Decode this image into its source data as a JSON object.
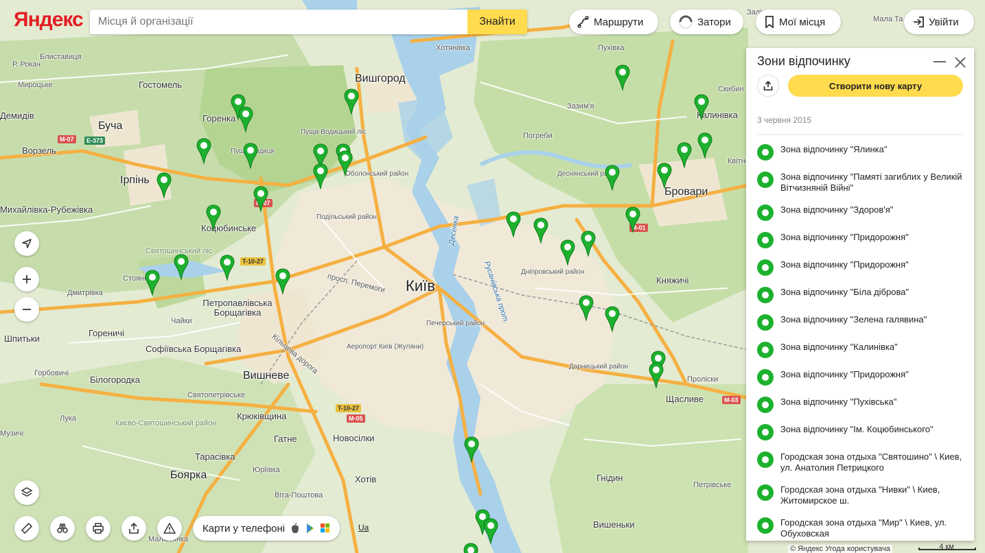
{
  "brand": {
    "logo": "Яндекс"
  },
  "search": {
    "placeholder": "Місця й організації",
    "value": "",
    "submit_label": "Знайти"
  },
  "top_buttons": {
    "routes": "Маршрути",
    "traffic": "Затори",
    "my_places": "Мої місця",
    "login": "Увійти"
  },
  "map": {
    "places": {
      "kyiv": "Київ",
      "vyshhorod": "Вишгород",
      "brovary": "Бровари",
      "irpin": "Ірпінь",
      "bucha": "Буча",
      "hostomel": "Гостомель",
      "vorzel": "Ворзель",
      "horenka": "Горенка",
      "kotsiubynske": "Коцюбинське",
      "boiarka": "Боярка",
      "vyshneve": "Вишневе",
      "vyshenky": "Вишеньки",
      "shchaslyve": "Щасливе",
      "petropavlivska": "Петропавлівська Борщагівка",
      "sofiivska": "Софіївська Борщагівка",
      "kniazhychi": "Княжичі",
      "kalynivka": "Калинівка",
      "pukhivka": "Пухівка",
      "hnidyn": "Гнідин",
      "khotiv": "Хотів",
      "novosilky": "Новосілки",
      "hatne": "Гатне",
      "kriukivshchyna": "Крюківщина",
      "tarasivka": "Тарасівка",
      "biluhorodka": "Білогородка",
      "horenychi": "Гореничі",
      "shpytky": "Шпитьки",
      "mykhailivka": "Михайлівка-Рубежівка",
      "bilytske": "Блиставиця",
      "myrotske": "Мироцьке",
      "demydiv": "Демидів",
      "khotianivka": "Хотянівка",
      "pohreby": "Погреби",
      "zazymia": "Зазим'я",
      "chaiky": "Чайки",
      "stoianka": "Стоянка",
      "dmytrivka": "Дмитрівка",
      "horbovychi": "Горбовичі",
      "luka": "Лука",
      "muzychi": "Музичі",
      "novosilky2": "Новосілки",
      "yurivka": "Юріївка",
      "vyta_poshtova": "Віта-Поштова",
      "malyutanka": "Малютянка",
      "sviatopetrivske": "Святопетрівське",
      "pushcha": "Пуща-Водицький ліс",
      "desnianskyi": "Деснянський район",
      "obolonskyi": "Оболонський район",
      "podilskyi": "Подільський район",
      "dniprovskyi": "Дніпровський район",
      "pecherskyi": "Печерський район",
      "darnytskyi": "Дарницький район",
      "airport": "Аеропорт Київ (Жуляни)",
      "prosp_peremohy": "просп. Перемоги",
      "kiltseva": "Кільцева дорога",
      "rusanivska": "Русанівська прот.",
      "desenka": "Десенка",
      "prolisky": "Проліски",
      "kyievo_sviatoshynskyi": "Києво-Святошинський район",
      "sviatoshynskyi": "Святошинський ліс",
      "skybyn": "Скибин",
      "kvitneve": "Квітневе",
      "zalissia": "Заліс",
      "mala_tataryvka": "Мала Та",
      "rokach": "Р. Рокач",
      "petrivske": "Петрівське",
      "puszcha_ditsia": "Пуща-Водиця"
    },
    "shields": {
      "m07a": "M-07",
      "e373": "E-373",
      "m07b": "M-07",
      "t1027a": "T-10-27",
      "t1027b": "T-10-27",
      "m05": "M-05",
      "m01": "M-01",
      "m03": "M-03"
    },
    "marker_count": 37
  },
  "controls": {
    "phone_label": "Карти у телефоні",
    "lang_link": "Ua"
  },
  "panel": {
    "title": "Зони відпочинку",
    "create_label": "Створити нову карту",
    "date": "3 червня 2015",
    "items": [
      "Зона відпочинку \"Ялинка\"",
      "Зона відпочинку \"Памяті загиблих у Великій Вітчизняній Війні\"",
      "Зона відпочинку \"Здоров'я\"",
      "Зона відпочинку \"Придорожня\"",
      "Зона відпочинку \"Придорожня\"",
      "Зона відпочинку \"Біла діброва\"",
      "Зона відпочинку \"Зелена галявина\"",
      "Зона відпочинку \"Калинівка\"",
      "Зона відпочинку \"Придорожня\"",
      "Зона відпочинку \"Пухівська\"",
      "Зона відпочинку \"Ім. Коцюбинського\"",
      "Городская зона отдыха \"Святошино\" \\ Киев, ул. Анатолия Петрицкого",
      "Городская зона отдыха \"Нивки\" \\ Киев, Житомирское ш.",
      "Городская зона отдыха \"Мир\" \\ Киев, ул. Обуховская"
    ]
  },
  "footer": {
    "copyright": "© Яндекс Угода користувача",
    "scale": "4 км"
  },
  "colors": {
    "marker": "#1db12e",
    "accent_yellow": "#ffdb4d",
    "water": "#a9d1ea",
    "forest": "#b9d79a",
    "road_major": "#f5b042",
    "road_minor": "#ffffff"
  }
}
